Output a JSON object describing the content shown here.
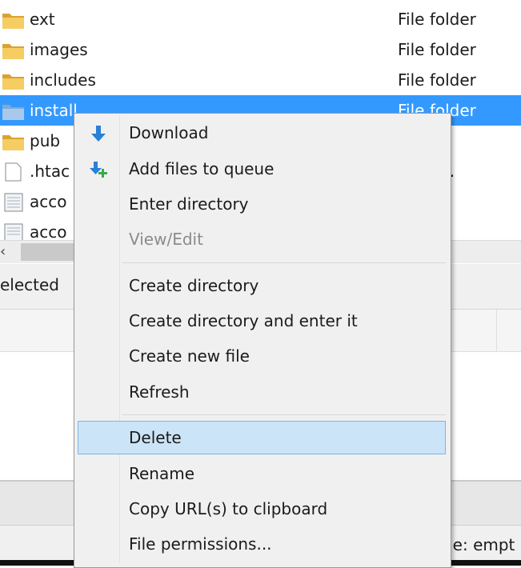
{
  "file_list": {
    "rows": [
      {
        "name": "ext",
        "type": "File folder",
        "icon": "folder-icon"
      },
      {
        "name": "images",
        "type": "File folder",
        "icon": "folder-icon"
      },
      {
        "name": "includes",
        "type": "File folder",
        "icon": "folder-icon"
      },
      {
        "name": "install",
        "type": "File folder",
        "icon": "folder-icon"
      },
      {
        "name": "pub",
        "type": "der",
        "icon": "folder-icon"
      },
      {
        "name": ".htac",
        "type": "CESS...",
        "icon": "file-icon"
      },
      {
        "name": "acco",
        "type": "le",
        "icon": "text-file-icon"
      },
      {
        "name": "acco",
        "type": "le",
        "icon": "text-file-icon"
      }
    ],
    "selected_index": 3
  },
  "status": {
    "selected_text": "elected",
    "queue_text": "ue: empt"
  },
  "context_menu": {
    "items": [
      {
        "label": "Download",
        "icon": "download-arrow-icon",
        "enabled": true
      },
      {
        "label": "Add files to queue",
        "icon": "add-to-queue-icon",
        "enabled": true
      },
      {
        "label": "Enter directory",
        "enabled": true
      },
      {
        "label": "View/Edit",
        "enabled": false
      },
      {
        "label": "Create directory",
        "enabled": true
      },
      {
        "label": "Create directory and enter it",
        "enabled": true
      },
      {
        "label": "Create new file",
        "enabled": true
      },
      {
        "label": "Refresh",
        "enabled": true
      },
      {
        "label": "Delete",
        "enabled": true,
        "highlighted": true
      },
      {
        "label": "Rename",
        "enabled": true
      },
      {
        "label": "Copy URL(s) to clipboard",
        "enabled": true
      },
      {
        "label": "File permissions...",
        "enabled": true
      }
    ]
  },
  "colors": {
    "selection": "#3399ff",
    "menu_highlight": "#cce4f7",
    "menu_background": "#f0f0f0",
    "folder": "#e8b84a",
    "download_arrow": "#2a7fd6",
    "queue_plus": "#3ba84a"
  }
}
